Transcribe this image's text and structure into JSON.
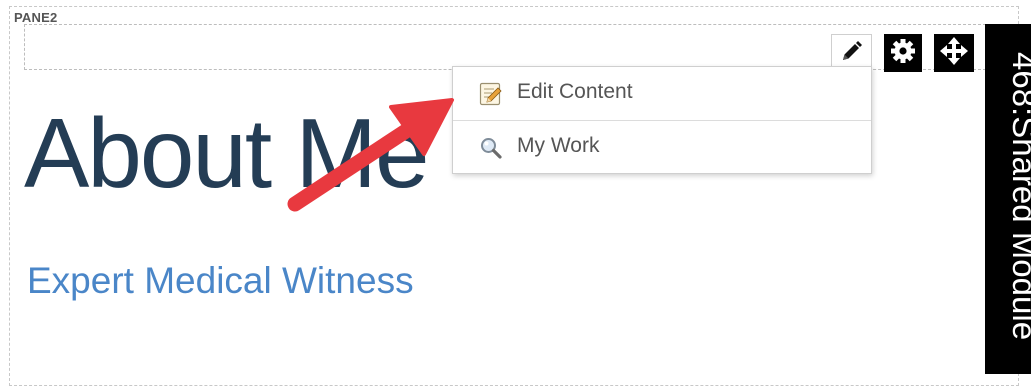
{
  "pane": {
    "label": "PANE2"
  },
  "content": {
    "title": "About Me",
    "subtitle": "Expert Medical Witness"
  },
  "toolbar": {
    "edit_icon": "pencil-icon",
    "settings_icon": "gear-icon",
    "move_icon": "move-arrows-icon"
  },
  "module_tab": {
    "label": "468:Shared Module"
  },
  "menu": {
    "items": [
      {
        "label": "Edit Content",
        "icon": "edit-document-icon"
      },
      {
        "label": "My Work",
        "icon": "magnifier-icon"
      }
    ]
  },
  "colors": {
    "title": "#243d55",
    "subtitle": "#4a86c8",
    "annotation_arrow": "#e8393f",
    "module_tab": "#000000"
  }
}
